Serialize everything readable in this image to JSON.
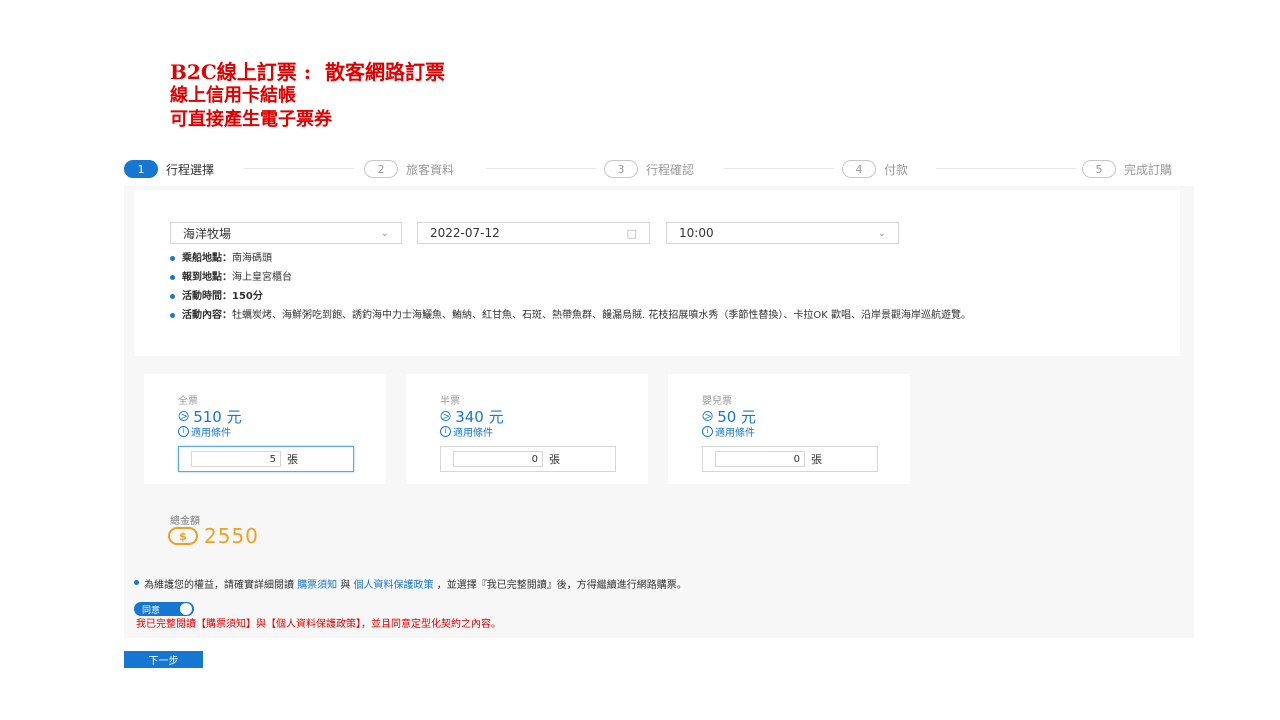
{
  "slide": {
    "title_line1": "B2C線上訂票 :  散客網路訂票",
    "title_line2": "線上信用卡結帳",
    "title_line3": "可直接產生電子票券"
  },
  "steps": [
    {
      "num": "1",
      "label": "行程選擇"
    },
    {
      "num": "2",
      "label": "旅客資料"
    },
    {
      "num": "3",
      "label": "行程確認"
    },
    {
      "num": "4",
      "label": "付款"
    },
    {
      "num": "5",
      "label": "完成訂購"
    }
  ],
  "selects": {
    "trip": "海洋牧場",
    "date": "2022-07-12",
    "time": "10:00"
  },
  "info": [
    {
      "label": "乘船地點：",
      "value": "南海碼頭"
    },
    {
      "label": "報到地點：",
      "value": "海上皇宮櫃台"
    },
    {
      "label": "活動時間：",
      "value": "150分"
    },
    {
      "label": "活動內容：",
      "value": "牡蠣炭烤、海鮮粥吃到飽、誘釣海中力士海鱺魚、鮪納、紅甘魚、石斑、熱帶魚群、饅漏烏賊. 花枝招展噴水秀（季節性替換）、卡拉OK 歡唱、沿岸景觀海岸巡航遊覽。"
    }
  ],
  "tickets": [
    {
      "name": "全票",
      "price": "510 元",
      "condition": "適用條件",
      "qty": "5",
      "unit": "張"
    },
    {
      "name": "半票",
      "price": "340 元",
      "condition": "適用條件",
      "qty": "0",
      "unit": "張"
    },
    {
      "name": "嬰兒票",
      "price": "50 元",
      "condition": "適用條件",
      "qty": "0",
      "unit": "張"
    }
  ],
  "total": {
    "label": "總金額",
    "currency_icon": "$",
    "amount": "2550"
  },
  "notice": {
    "prefix": "為維護您的權益，請確實詳細閱讀",
    "link1": "購票須知",
    "mid": "與",
    "link2": "個人資料保護政策",
    "suffix": "，並選擇『我已完整閱讀』後，方得繼續進行網路購票。"
  },
  "agree": {
    "toggle_label": "同意",
    "text": "我已完整閱讀【購票須知】與【個人資料保護政策】，並且同意定型化契約之內容。"
  },
  "next_button": "下一步",
  "colors": {
    "accent": "#1677d2",
    "warning": "#e00000",
    "gold": "#f0a020"
  }
}
